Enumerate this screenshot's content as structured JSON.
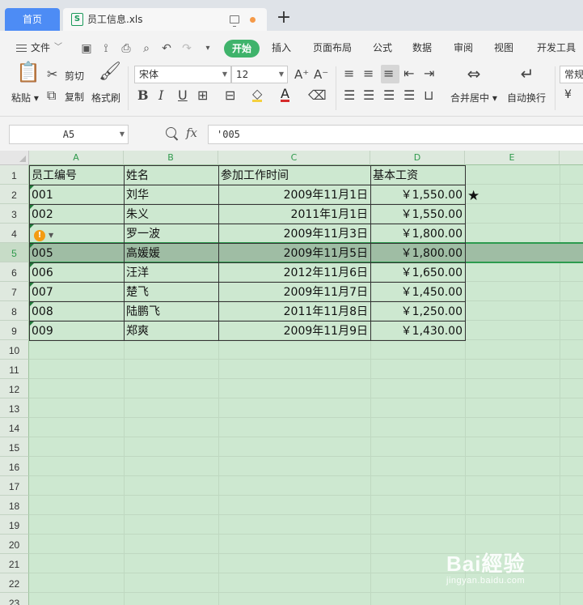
{
  "tabs": {
    "home_label": "首页",
    "file_label": "员工信息.xls",
    "file_icon_letter": "S"
  },
  "menubar": {
    "file_label": "文件",
    "items": [
      "开始",
      "插入",
      "页面布局",
      "公式",
      "数据",
      "审阅",
      "视图",
      "开发工具"
    ]
  },
  "ribbon": {
    "paste_label": "粘贴",
    "cut_label": "剪切",
    "copy_label": "复制",
    "format_painter_label": "格式刷",
    "font_name": "宋体",
    "font_size": "12",
    "merge_label": "合并居中",
    "wrap_label": "自动换行",
    "number_format": "常规",
    "currency_symbol": "¥"
  },
  "formula_bar": {
    "cell_ref": "A5",
    "fx_label": "fx",
    "content": "'005"
  },
  "sheet": {
    "columns": [
      "A",
      "B",
      "C",
      "D",
      "E"
    ],
    "row_numbers": [
      "1",
      "2",
      "3",
      "4",
      "5",
      "6",
      "7",
      "8",
      "9",
      "10",
      "11",
      "12",
      "13",
      "14",
      "15",
      "16",
      "17",
      "18",
      "19",
      "20",
      "21",
      "22",
      "23"
    ],
    "headers": [
      "员工编号",
      "姓名",
      "参加工作时间",
      "基本工资"
    ],
    "rows": [
      {
        "id": "001",
        "name": "刘华",
        "date": "2009年11月1日",
        "salary": "￥1,550.00"
      },
      {
        "id": "002",
        "name": "朱义",
        "date": "2011年1月1日",
        "salary": "￥1,550.00"
      },
      {
        "id": "",
        "name": "罗一波",
        "date": "2009年11月3日",
        "salary": "￥1,800.00"
      },
      {
        "id": "005",
        "name": "高媛媛",
        "date": "2009年11月5日",
        "salary": "￥1,800.00"
      },
      {
        "id": "006",
        "name": "汪洋",
        "date": "2012年11月6日",
        "salary": "￥1,650.00"
      },
      {
        "id": "007",
        "name": "楚飞",
        "date": "2009年11月7日",
        "salary": "￥1,450.00"
      },
      {
        "id": "008",
        "name": "陆鹏飞",
        "date": "2011年11月8日",
        "salary": "￥1,250.00"
      },
      {
        "id": "009",
        "name": "郑爽",
        "date": "2009年11月9日",
        "salary": "￥1,430.00"
      }
    ],
    "star_mark": "★",
    "warning_symbol": "!",
    "selected_row": "5"
  },
  "watermark": {
    "brand": "Bai經验",
    "url": "jingyan.baidu.com"
  },
  "colors": {
    "home_tab": "#4d8cf5",
    "start_pill": "#3fb36b",
    "sheet_bg": "#cde8d0",
    "selected_row": "#9fbda4",
    "accent_green": "#2f9a4c"
  }
}
